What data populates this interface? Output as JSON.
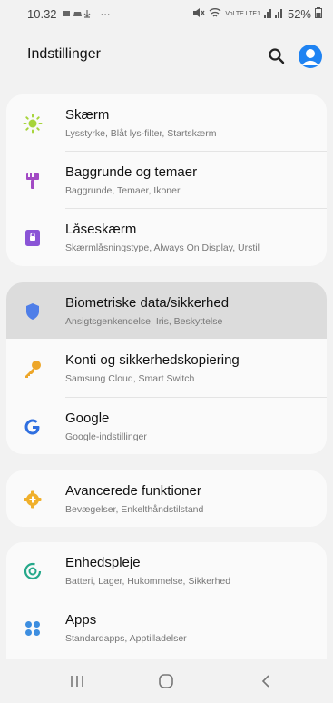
{
  "status_bar": {
    "time": "10.32",
    "dots": "···",
    "network": "VoLTE LTE1",
    "battery": "52%"
  },
  "header": {
    "title": "Indstillinger"
  },
  "settings": {
    "screen": {
      "title": "Skærm",
      "subtitle": "Lysstyrke, Blåt lys-filter, Startskærm",
      "icon": "sun-icon",
      "color": "#a6d43a"
    },
    "wallpaper": {
      "title": "Baggrunde og temaer",
      "subtitle": "Baggrunde, Temaer, Ikoner",
      "icon": "paintbrush-icon",
      "color": "#a24ac4"
    },
    "lockscreen": {
      "title": "Låseskærm",
      "subtitle": "Skærmlåsningstype, Always On Display, Urstil",
      "icon": "lock-icon",
      "color": "#8a54d6"
    },
    "biometrics": {
      "title": "Biometriske data/sikkerhed",
      "subtitle": "Ansigtsgenkendelse, Iris, Beskyttelse",
      "icon": "shield-icon",
      "color": "#4f7ee8"
    },
    "accounts": {
      "title": "Konti og sikkerhedskopiering",
      "subtitle": "Samsung Cloud, Smart Switch",
      "icon": "key-icon",
      "color": "#eda629"
    },
    "google": {
      "title": "Google",
      "subtitle": "Google-indstillinger",
      "icon": "google-icon",
      "color": "#2f6fe0"
    },
    "advanced": {
      "title": "Avancerede funktioner",
      "subtitle": "Bevægelser, Enkelthåndstilstand",
      "icon": "gear-plus-icon",
      "color": "#f0b02c"
    },
    "device_care": {
      "title": "Enhedspleje",
      "subtitle": "Batteri, Lager, Hukommelse, Sikkerhed",
      "icon": "device-care-icon",
      "color": "#25a88a"
    },
    "apps": {
      "title": "Apps",
      "subtitle": "Standardapps, Apptilladelser",
      "icon": "apps-grid-icon",
      "color": "#3d8ee0"
    }
  }
}
